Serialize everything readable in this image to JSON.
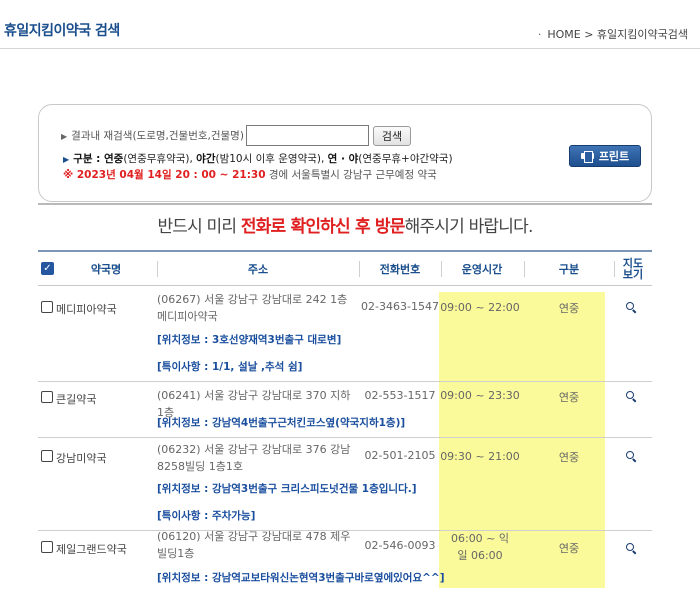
{
  "page_title": "휴일지킴이약국 검색",
  "breadcrumb": {
    "dot": "·",
    "text": "HOME > 휴일지킴이약국검색"
  },
  "search": {
    "arrow": "▶",
    "label": "결과내 재검색(도로명,건물번호,건물명)",
    "value": "",
    "button": "검색",
    "legend_prefix": "구분 : ",
    "legend_1b": "연중",
    "legend_1": "(연중무휴약국), ",
    "legend_2b": "야간",
    "legend_2": "(밤10시 이후 운영약국), ",
    "legend_3b": "연 · 야",
    "legend_3": "(연중무휴+야간약국)",
    "date_mark": "※ 2023년 04월 14일 20 : 00 ~ 21:30",
    "date_rest": " 경에  서울특별시  강남구   근무예정 약국"
  },
  "print_button": "프린트",
  "notice": {
    "pre": "반드시 미리 ",
    "red": "전화로 확인하신 후 방문",
    "post": "해주시기 바랍니다."
  },
  "table": {
    "check_mark": "✓",
    "columns": [
      "약국명",
      "주소",
      "전화번호",
      "운영시간",
      "구분",
      "지도보기"
    ],
    "rows": [
      {
        "name": "메디피아약국",
        "address": "(06267) 서울 강남구 강남대로 242 1층 메디피아약국",
        "location": "[위치정보 : 3호선양재역3번출구 대로변]",
        "special": "[특이사항 : 1/1, 설날 ,추석 쉼]",
        "phone": "02-3463-1547",
        "hours": "09:00 ~ 22:00",
        "type": "연중"
      },
      {
        "name": "큰길약국",
        "address": "(06241) 서울 강남구 강남대로 370 지하1층",
        "location": "[위치정보 : 강남역4번출구근처킨코스옆(약국지하1층)]",
        "special": "",
        "phone": "02-553-1517",
        "hours": "09:00 ~ 23:30",
        "type": "연중"
      },
      {
        "name": "강남미약국",
        "address": "(06232) 서울 강남구 강남대로 376 강남8258빌딩 1층1호",
        "location": "[위치정보 : 강남역3번출구 크리스피도넛건물 1층입니다.]",
        "special": "[특이사항 : 주차가능]",
        "phone": "02-501-2105",
        "hours": "09:30 ~ 21:00",
        "type": "연중"
      },
      {
        "name": "제일그랜드약국",
        "address": "(06120) 서울 강남구 강남대로 478 제우빌딩1층",
        "location": "[위치정보 : 강남역교보타워신논현역3번출구바로옆에있어요^^]",
        "special": "",
        "phone": "02-546-0093",
        "hours": "06:00 ~ 익일 06:00",
        "type": "연중"
      }
    ]
  },
  "colors": {
    "title": "#1a4e8c",
    "accent_red": "#e02020",
    "link_blue": "#1a4e9e",
    "highlight": "#fafa8f"
  }
}
